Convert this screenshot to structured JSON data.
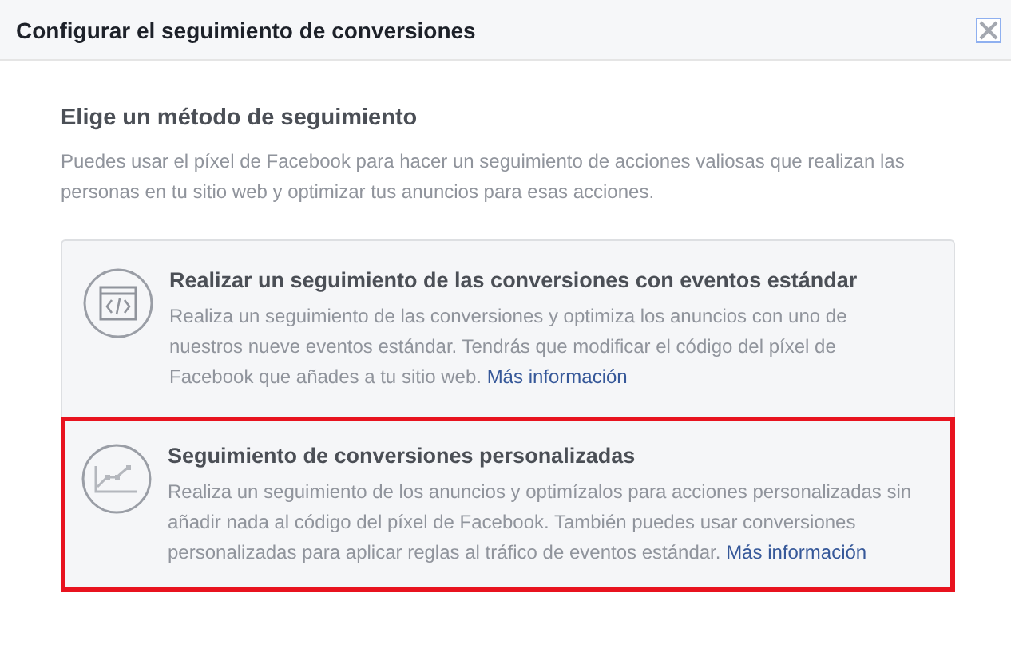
{
  "dialog": {
    "title": "Configurar el seguimiento de conversiones"
  },
  "heading": "Elige un método de seguimiento",
  "description": "Puedes usar el píxel de Facebook para hacer un seguimiento de acciones valiosas que realizan las personas en tu sitio web y optimizar tus anuncios para esas acciones.",
  "options": [
    {
      "kind": "code",
      "title": "Realizar un seguimiento de las conversiones con eventos estándar",
      "text": "Realiza un seguimiento de las conversiones y optimiza los anuncios con uno de nuestros nueve eventos estándar. Tendrás que modificar el código del píxel de Facebook que añades a tu sitio web.",
      "link": "Más información",
      "highlighted": false
    },
    {
      "kind": "chart",
      "title": "Seguimiento de conversiones personalizadas",
      "text": "Realiza un seguimiento de los anuncios y optimízalos para acciones personalizadas sin añadir nada al código del píxel de Facebook. También puedes usar conversiones personalizadas para aplicar reglas al tráfico de eventos estándar.",
      "link": "Más información",
      "highlighted": true
    }
  ]
}
